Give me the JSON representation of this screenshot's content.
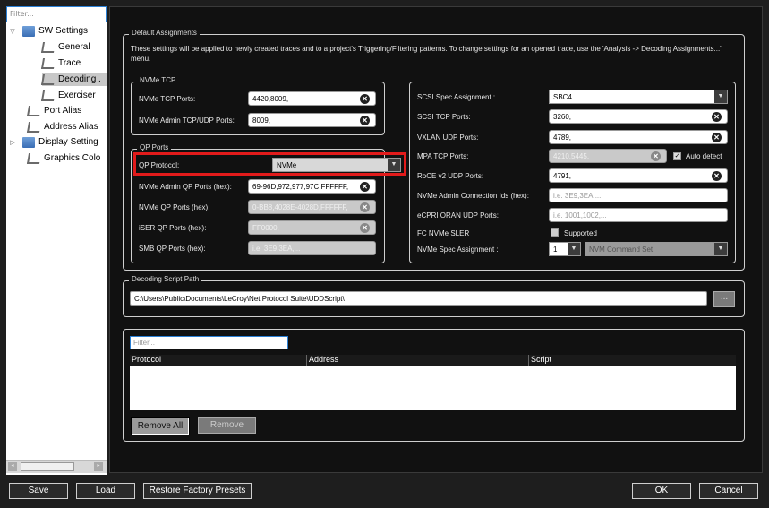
{
  "tree": {
    "filter_placeholder": "Filter...",
    "items": [
      {
        "label": "SW Settings",
        "expander": "▽"
      },
      {
        "label": "General"
      },
      {
        "label": "Trace"
      },
      {
        "label": "Decoding ."
      },
      {
        "label": "Exerciser"
      },
      {
        "label": "Port Alias"
      },
      {
        "label": "Address Alias"
      },
      {
        "label": "Display Setting",
        "expander": "▷"
      },
      {
        "label": "Graphics Colo"
      }
    ]
  },
  "default_assignments": {
    "title": "Default Assignments",
    "description": "These settings will be applied to newly created traces and to a project's Triggering/Filtering patterns.  To change settings for an opened trace, use the 'Analysis -> Decoding Assignments...' menu."
  },
  "nvme_tcp": {
    "title": "NVMe TCP",
    "tcp_ports_label": "NVMe TCP Ports:",
    "tcp_ports_value": "4420,8009,",
    "admin_ports_label": "NVMe Admin TCP/UDP Ports:",
    "admin_ports_value": "8009,"
  },
  "qp_ports": {
    "title": "QP Ports",
    "protocol_label": "QP Protocol:",
    "protocol_value": "NVMe",
    "admin_qp_label": "NVMe Admin QP Ports (hex):",
    "admin_qp_value": "69-96D,972,977,97C,FFFFFF,",
    "nvme_qp_label": "NVMe QP Ports (hex):",
    "nvme_qp_value": "0-BB8,4028E-4028D,FFFFFF,",
    "iser_label": "iSER QP Ports (hex):",
    "iser_value": "FF0000,",
    "smb_label": "SMB QP Ports (hex):",
    "smb_placeholder": "i.e. 3E9,3EA,..."
  },
  "right": {
    "scsi_spec_label": "SCSI Spec Assignment :",
    "scsi_spec_value": "SBC4",
    "scsi_tcp_label": "SCSI TCP Ports:",
    "scsi_tcp_value": "3260,",
    "vxlan_label": "VXLAN UDP Ports:",
    "vxlan_value": "4789,",
    "mpa_label": "MPA TCP Ports:",
    "mpa_value": "4210,5445,",
    "auto_detect_label": "Auto detect",
    "rocev2_label": "RoCE v2 UDP Ports:",
    "rocev2_value": "4791,",
    "nvme_admin_conn_label": "NVMe Admin Connection Ids (hex):",
    "nvme_admin_conn_placeholder": "i.e. 3E9,3EA,...",
    "ecpri_label": "eCPRI ORAN UDP Ports:",
    "ecpri_placeholder": "i.e. 1001,1002,...",
    "fc_nvme_label": "FC NVMe SLER",
    "supported_label": "Supported",
    "nvme_spec_label": "NVMe Spec Assignment :",
    "nvme_spec_num": "1",
    "nvme_spec_value": "NVM Command Set"
  },
  "decoding_script": {
    "title": "Decoding Script Path",
    "path": "C:\\Users\\Public\\Documents\\LeCroy\\Net Protocol Suite\\UDDScript\\",
    "browse_label": "..."
  },
  "script_table": {
    "filter_placeholder": "Filter...",
    "columns": [
      "Protocol",
      "Address",
      "Script"
    ],
    "remove_all_label": "Remove All",
    "remove_label": "Remove"
  },
  "footer": {
    "save": "Save",
    "load": "Load",
    "restore": "Restore Factory Presets",
    "ok": "OK",
    "cancel": "Cancel"
  }
}
